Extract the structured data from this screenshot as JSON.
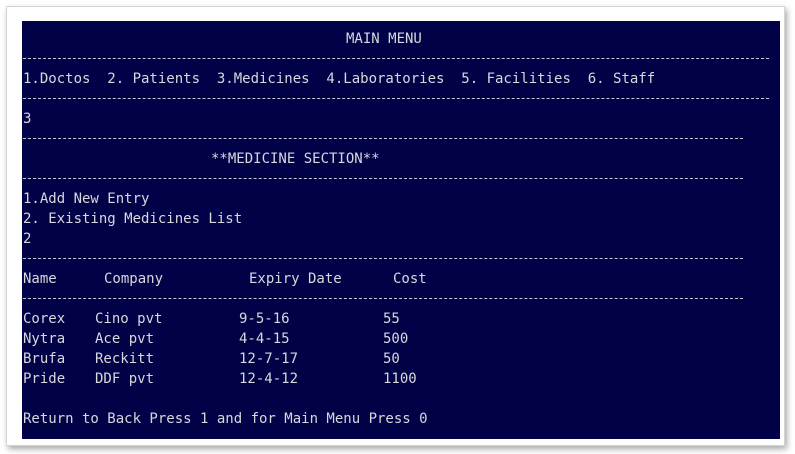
{
  "menu": {
    "title": "MAIN MENU",
    "options": "1.Doctos  2. Patients  3.Medicines  4.Laboratories  5. Facilities  6. Staff",
    "choice": "3"
  },
  "section": {
    "title": "**MEDICINE SECTION**",
    "option_add": "1.Add New Entry",
    "option_list": "2. Existing Medicines List",
    "choice": "2"
  },
  "table": {
    "headers": [
      "Name",
      "Company",
      "Expiry Date",
      "Cost"
    ],
    "rows": [
      [
        "Corex",
        "Cino pvt",
        "9-5-16",
        "55"
      ],
      [
        "Nytra",
        "Ace pvt",
        "4-4-15",
        "500"
      ],
      [
        "Brufa",
        "Reckitt",
        "12-7-17",
        "50"
      ],
      [
        "Pride",
        "DDF pvt",
        "12-4-12",
        "1100"
      ]
    ]
  },
  "footer": {
    "prompt": "Return to Back Press 1 and for Main Menu Press 0"
  }
}
